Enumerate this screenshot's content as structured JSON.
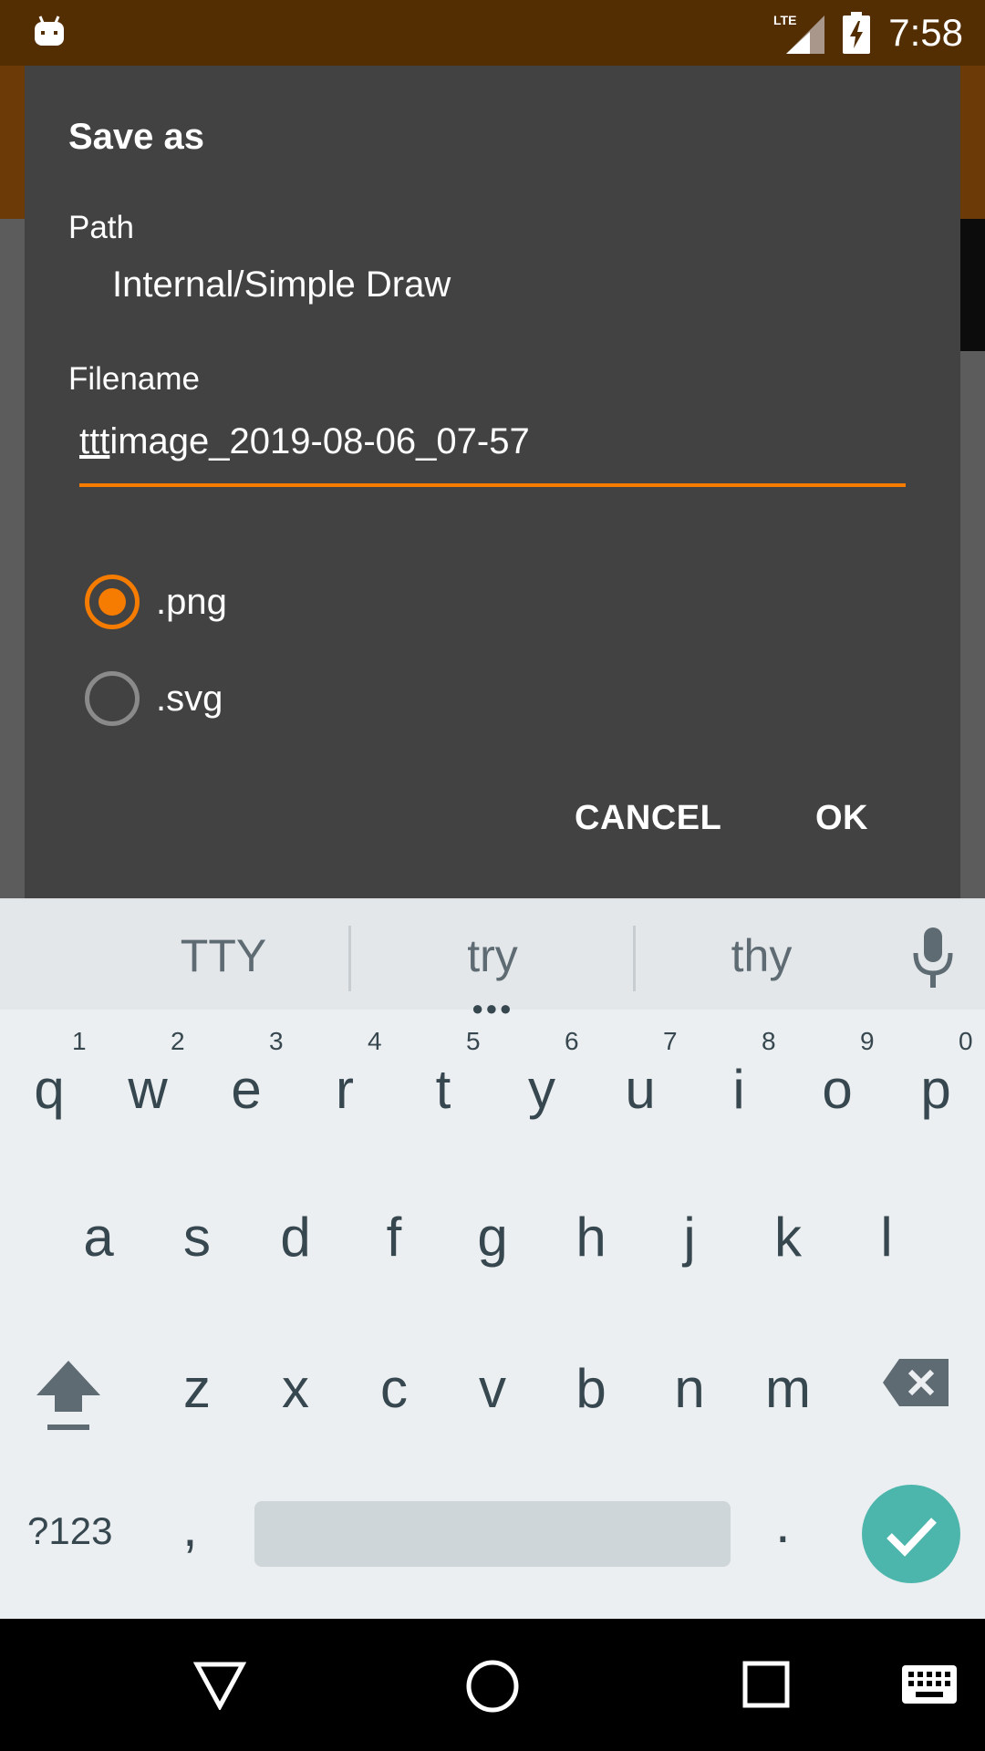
{
  "status_bar": {
    "time": "7:58",
    "network": "LTE",
    "icons": [
      "app-notification-icon",
      "lte-signal-icon",
      "battery-charging-icon"
    ]
  },
  "dialog": {
    "title": "Save as",
    "path_label": "Path",
    "path_value": "Internal/Simple Draw",
    "filename_label": "Filename",
    "filename_composing": "ttt",
    "filename_rest": "image_2019-08-06_07-57",
    "format_options": [
      {
        "label": ".png",
        "checked": true
      },
      {
        "label": ".svg",
        "checked": false
      }
    ],
    "cancel_label": "CANCEL",
    "ok_label": "OK",
    "accent_color": "#f57c00"
  },
  "keyboard": {
    "suggestions": [
      "TTY",
      "try",
      "thy"
    ],
    "row1": [
      "q",
      "w",
      "e",
      "r",
      "t",
      "y",
      "u",
      "i",
      "o",
      "p"
    ],
    "row1_hints": [
      "1",
      "2",
      "3",
      "4",
      "5",
      "6",
      "7",
      "8",
      "9",
      "0"
    ],
    "row2": [
      "a",
      "s",
      "d",
      "f",
      "g",
      "h",
      "j",
      "k",
      "l"
    ],
    "row3": [
      "z",
      "x",
      "c",
      "v",
      "b",
      "n",
      "m"
    ],
    "symbols_label": "?123",
    "comma": ",",
    "period": ".",
    "enter_color": "#4db6ac"
  },
  "nav_bar": {
    "icons": [
      "back-icon",
      "home-icon",
      "recents-icon",
      "keyboard-switch-icon"
    ]
  }
}
